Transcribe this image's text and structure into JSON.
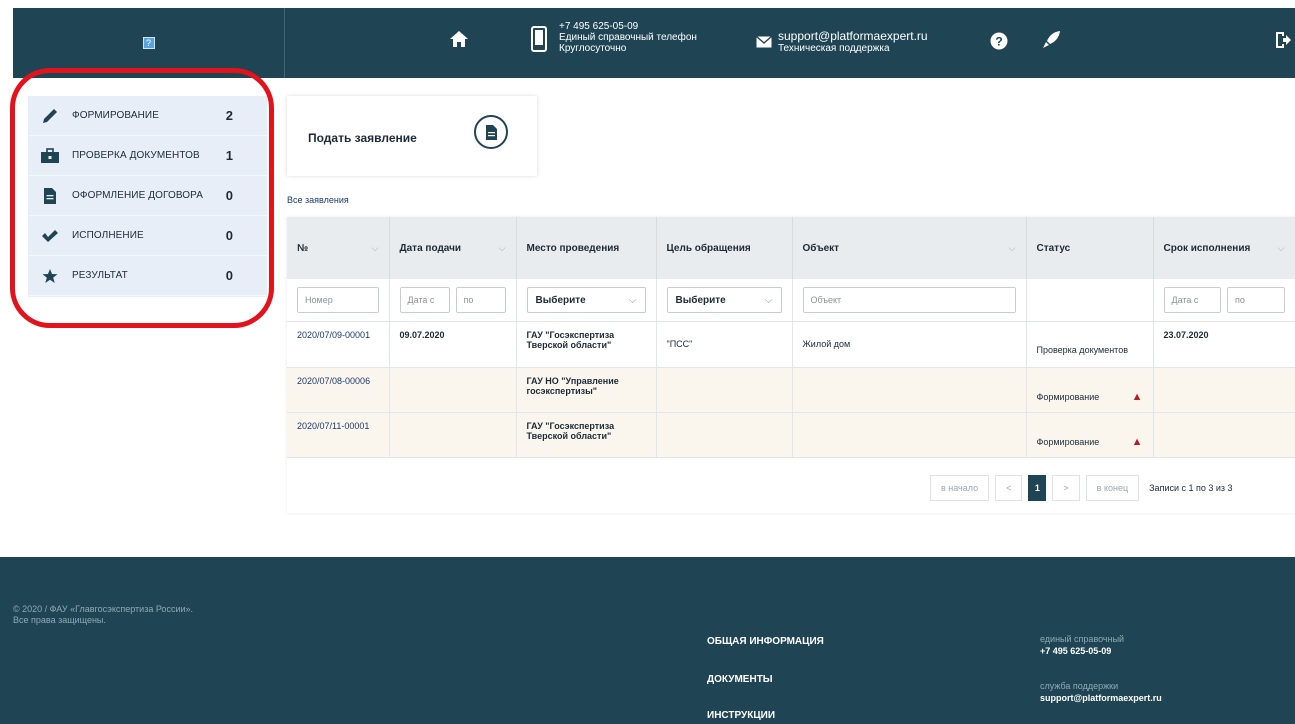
{
  "header": {
    "logo_mark": "?",
    "phone_number": "+7 495 625-05-09",
    "phone_desc1": "Единый справочный телефон",
    "phone_desc2": "Круглосуточно",
    "email": "support@platformaexpert.ru",
    "email_desc": "Техническая поддержка"
  },
  "sidebar": {
    "items": [
      {
        "label": "ФОРМИРОВАНИЕ",
        "count": "2",
        "icon": "pen-icon"
      },
      {
        "label": "ПРОВЕРКА ДОКУМЕНТОВ",
        "count": "1",
        "icon": "briefcase-icon"
      },
      {
        "label": "ОФОРМЛЕНИЕ ДОГОВОРА",
        "count": "0",
        "icon": "document-icon"
      },
      {
        "label": "ИСПОЛНЕНИЕ",
        "count": "0",
        "icon": "checkmark-icon"
      },
      {
        "label": "РЕЗУЛЬТАТ",
        "count": "0",
        "icon": "star-icon"
      }
    ]
  },
  "card": {
    "title": "Подать заявление"
  },
  "all_link": "Все заявления",
  "table": {
    "headers": [
      "№",
      "Дата подачи",
      "Место проведения",
      "Цель обращения",
      "Объект",
      "Статус",
      "Срок исполнения"
    ],
    "filters": {
      "number": "Номер",
      "date_from": "Дата с",
      "date_to": "по",
      "place": "Выберите",
      "goal": "Выберите",
      "object": "Объект",
      "deadline_from": "Дата с",
      "deadline_to": "по"
    },
    "rows": [
      {
        "number": "2020/07/09-00001",
        "date": "09.07.2020",
        "place": "ГАУ \"Госэкспертиза Тверской области\"",
        "goal": "\"ПСС\"",
        "object": "Жилой дом",
        "status": "Проверка документов",
        "deadline": "23.07.2020"
      },
      {
        "number": "2020/07/08-00006",
        "date": "",
        "place": "ГАУ НО \"Управление госэкспертизы\"",
        "goal": "",
        "object": "",
        "status": "Формирование",
        "deadline": ""
      },
      {
        "number": "2020/07/11-00001",
        "date": "",
        "place": "ГАУ \"Госэкспертиза Тверской области\"",
        "goal": "",
        "object": "",
        "status": "Формирование",
        "deadline": ""
      }
    ]
  },
  "pager": {
    "first": "в начало",
    "prev": "<",
    "current": "1",
    "next": ">",
    "last": "в конец",
    "info": "Записи с 1 по 3 из 3"
  },
  "footer": {
    "copy_line1": "© 2020 / ФАУ «Главгосэкспертиза России».",
    "copy_line2": "Все права защищены.",
    "links": [
      "ОБЩАЯ ИНФОРМАЦИЯ",
      "ДОКУМЕНТЫ",
      "ИНСТРУКЦИИ"
    ],
    "phone_label": "единый справочный",
    "phone_value": "+7 495 625-05-09",
    "support_label": "служба поддержки",
    "support_value": "support@platformaexpert.ru"
  },
  "colors": {
    "header_bg": "#1f4555",
    "sidebar_bg": "#e7eef7",
    "highlight": "#e3121b",
    "row_alt": "#faf6ee"
  }
}
